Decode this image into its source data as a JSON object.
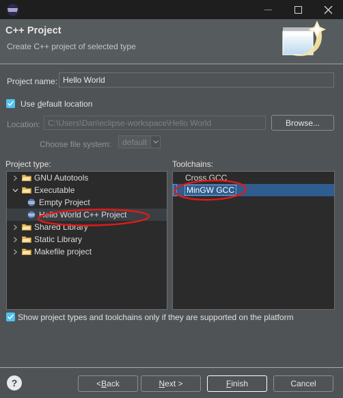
{
  "window": {
    "app_icon": "eclipse-logo-icon",
    "controls": [
      {
        "name": "minimize",
        "glyph": "minimize-icon"
      },
      {
        "name": "maximize",
        "glyph": "maximize-icon"
      },
      {
        "name": "close",
        "glyph": "close-icon"
      }
    ]
  },
  "header": {
    "title": "C++ Project",
    "subtitle": "Create C++ project of selected type",
    "art": "new-cpp-project-wizard-banner-icon"
  },
  "form": {
    "project_name_label": "Project name:",
    "project_name_value": "Hello World",
    "project_name_placeholder": "",
    "use_default_location_label": "Use default location",
    "use_default_location_checked": true,
    "location_label": "Location:",
    "location_value": "C:\\Users\\Dan\\eclipse-workspace\\Hello World",
    "location_enabled": false,
    "browse_label": "Browse...",
    "file_system_label": "Choose file system:",
    "file_system_value": "default",
    "file_system_options": [
      "default"
    ]
  },
  "project_type": {
    "label": "Project type:",
    "items": [
      {
        "label": "GNU Autotools",
        "indent": 0,
        "twisty": "collapsed",
        "icon": "folder-icon",
        "selected": false
      },
      {
        "label": "Executable",
        "indent": 0,
        "twisty": "expanded",
        "icon": "folder-icon",
        "selected": false
      },
      {
        "label": "Empty Project",
        "indent": 1,
        "twisty": "none",
        "icon": "project-icon",
        "selected": false
      },
      {
        "label": "Hello World C++ Project",
        "indent": 1,
        "twisty": "none",
        "icon": "project-icon",
        "selected": true
      },
      {
        "label": "Shared Library",
        "indent": 0,
        "twisty": "collapsed",
        "icon": "folder-icon",
        "selected": false
      },
      {
        "label": "Static Library",
        "indent": 0,
        "twisty": "collapsed",
        "icon": "folder-icon",
        "selected": false
      },
      {
        "label": "Makefile project",
        "indent": 0,
        "twisty": "collapsed",
        "icon": "folder-icon",
        "selected": false
      }
    ]
  },
  "toolchains": {
    "label": "Toolchains:",
    "items": [
      {
        "label": "Cross GCC",
        "selected": false
      },
      {
        "label": "MinGW GCC",
        "selected": true
      }
    ]
  },
  "options": {
    "show_supported_label": "Show project types and toolchains only if they are supported on the platform",
    "show_supported_checked": true
  },
  "footer": {
    "help_glyph": "?",
    "buttons": [
      {
        "name": "back",
        "label": "< Back",
        "mnemonic": "B",
        "default": false,
        "enabled": true
      },
      {
        "name": "next",
        "label": "Next >",
        "mnemonic": "N",
        "default": false,
        "enabled": true
      },
      {
        "name": "finish",
        "label": "Finish",
        "mnemonic": "F",
        "default": true,
        "enabled": true
      },
      {
        "name": "cancel",
        "label": "Cancel",
        "mnemonic": "",
        "default": false,
        "enabled": true
      }
    ]
  },
  "annotations": [
    {
      "name": "annotation-hello-world-project",
      "shape": "ellipse"
    },
    {
      "name": "annotation-mingw-gcc",
      "shape": "ellipse"
    }
  ],
  "colors": {
    "titlebar_bg": "#1e1e1e",
    "header_bg": "#565b5e",
    "dialog_bg": "#4f5356",
    "list_bg": "#2b2b2b",
    "accent_checkbox": "#4ec3f0",
    "selection_blue": "#2f5d8f",
    "annotation_red": "#e01b18",
    "text": "#e0e0e0",
    "text_dim": "#8f9496"
  }
}
